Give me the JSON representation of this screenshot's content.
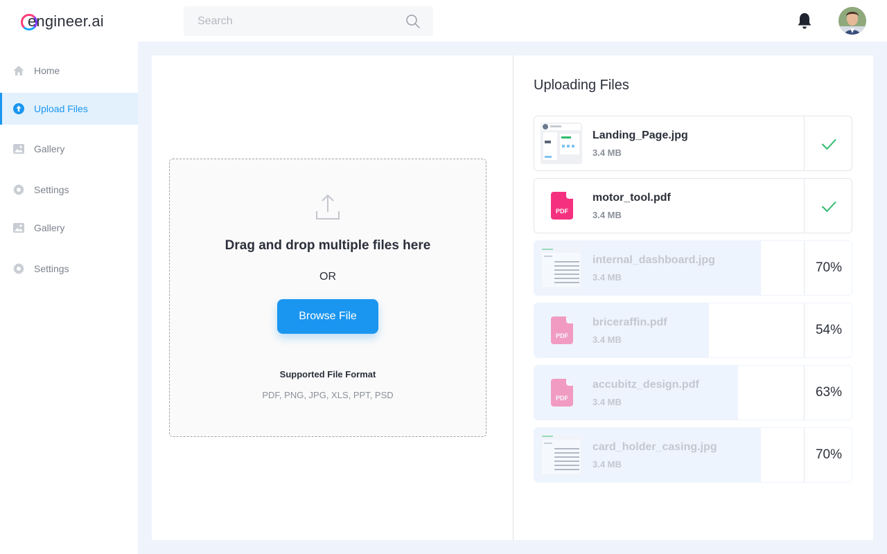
{
  "app": {
    "logo_text": "engineer.ai"
  },
  "header": {
    "search_placeholder": "Search"
  },
  "sidebar": {
    "items": [
      {
        "label": "Home",
        "icon": "home-icon",
        "active": false
      },
      {
        "label": "Upload Files",
        "icon": "upload-icon",
        "active": true
      },
      {
        "label": "Gallery",
        "icon": "gallery-icon",
        "active": false
      },
      {
        "label": "Settings",
        "icon": "gear-icon",
        "active": false
      },
      {
        "label": "Gallery",
        "icon": "gallery-icon",
        "active": false
      },
      {
        "label": "Settings",
        "icon": "gear-icon",
        "active": false
      }
    ]
  },
  "dropzone": {
    "title": "Drag and drop multiple files here",
    "or": "OR",
    "browse_label": "Browse File",
    "formats_title": "Supported File Format",
    "formats_list": "PDF, PNG, JPG, XLS, PPT, PSD"
  },
  "uploads": {
    "title": "Uploading Files",
    "files": [
      {
        "name": "Landing_Page.jpg",
        "size": "3.4 MB",
        "type": "jpg",
        "status": "done"
      },
      {
        "name": "motor_tool.pdf",
        "size": "3.4 MB",
        "type": "pdf",
        "status": "done"
      },
      {
        "name": "internal_dashboard.jpg",
        "size": "3.4 MB",
        "type": "jpg",
        "status": "uploading",
        "progress": 70,
        "progress_label": "70%"
      },
      {
        "name": "briceraffin.pdf",
        "size": "3.4 MB",
        "type": "pdf",
        "status": "uploading",
        "progress": 54,
        "progress_label": "54%"
      },
      {
        "name": "accubitz_design.pdf",
        "size": "3.4 MB",
        "type": "pdf",
        "status": "uploading",
        "progress": 63,
        "progress_label": "63%"
      },
      {
        "name": "card_holder_casing.jpg",
        "size": "3.4 MB",
        "type": "jpg",
        "status": "uploading",
        "progress": 70,
        "progress_label": "70%"
      }
    ],
    "pdf_badge": "PDF"
  },
  "colors": {
    "accent": "#1a96f0",
    "success": "#2dbb6a",
    "pdf": "#f5317f"
  }
}
